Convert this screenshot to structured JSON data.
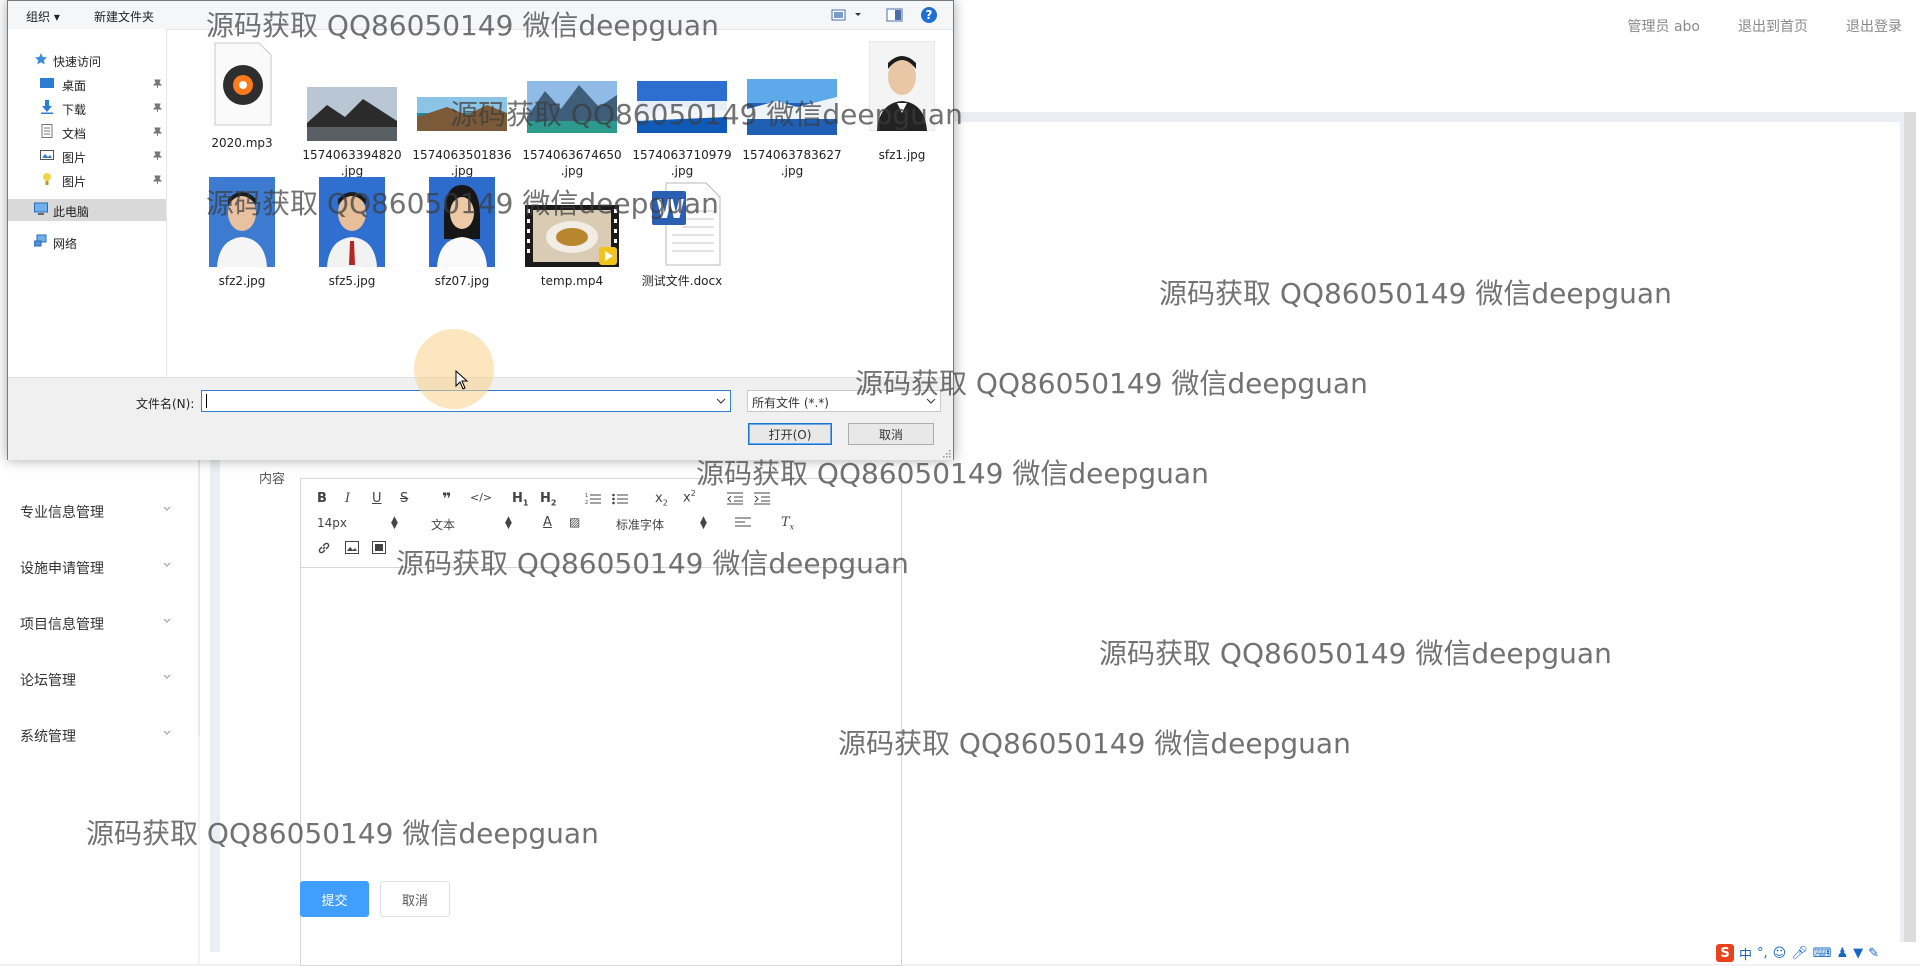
{
  "header": {
    "links": [
      "管理员 abo",
      "退出到首页",
      "退出登录"
    ]
  },
  "sidebar": {
    "items": [
      {
        "label": "专业信息管理"
      },
      {
        "label": "设施申请管理"
      },
      {
        "label": "项目信息管理"
      },
      {
        "label": "论坛管理"
      },
      {
        "label": "系统管理"
      }
    ]
  },
  "form": {
    "content_label": "内容",
    "editor": {
      "toolbar_row2": {
        "font_size": "14px",
        "paragraph": "文本",
        "font_family": "标准字体"
      }
    },
    "submit_label": "提交",
    "cancel_label": "取消"
  },
  "dialog": {
    "toolbar": {
      "organize": "组织 ▾",
      "new_folder": "新建文件夹"
    },
    "nav": [
      {
        "label": "快速访问",
        "icon": "star-icon"
      },
      {
        "label": "桌面",
        "icon": "desktop-icon"
      },
      {
        "label": "下载",
        "icon": "download-icon"
      },
      {
        "label": "文档",
        "icon": "document-icon"
      },
      {
        "label": "图片",
        "icon": "pictures-icon"
      },
      {
        "label": "图片",
        "icon": "pictures-folder-icon"
      },
      {
        "label": "此电脑",
        "icon": "computer-icon"
      },
      {
        "label": "网络",
        "icon": "network-icon"
      }
    ],
    "files": [
      {
        "name_line1": "2020.mp3",
        "name_line2": "",
        "kind": "audio"
      },
      {
        "name_line1": "1574063394820",
        "name_line2": ".jpg",
        "kind": "image"
      },
      {
        "name_line1": "1574063501836",
        "name_line2": ".jpg",
        "kind": "image"
      },
      {
        "name_line1": "1574063674650",
        "name_line2": ".jpg",
        "kind": "image"
      },
      {
        "name_line1": "1574063710979",
        "name_line2": ".jpg",
        "kind": "image"
      },
      {
        "name_line1": "1574063783627",
        "name_line2": ".jpg",
        "kind": "image"
      },
      {
        "name_line1": "sfz1.jpg",
        "name_line2": "",
        "kind": "portrait"
      },
      {
        "name_line1": "sfz2.jpg",
        "name_line2": "",
        "kind": "portrait"
      },
      {
        "name_line1": "sfz5.jpg",
        "name_line2": "",
        "kind": "portrait"
      },
      {
        "name_line1": "sfz07.jpg",
        "name_line2": "",
        "kind": "portrait"
      },
      {
        "name_line1": "temp.mp4",
        "name_line2": "",
        "kind": "video"
      },
      {
        "name_line1": "测试文件.docx",
        "name_line2": "",
        "kind": "word"
      }
    ],
    "filename_label": "文件名(N):",
    "filename_value": "",
    "filter_value": "所有文件 (*.*)",
    "open_label": "打开(O)",
    "cancel_label": "取消"
  },
  "watermark": "源码获取 QQ86050149 微信deepguan",
  "tray": [
    "中",
    "°,"
  ],
  "colors": {
    "primary": "#409eff",
    "selected_nav": "#d9d9d9",
    "dialog_border": "#7a7a7a"
  }
}
